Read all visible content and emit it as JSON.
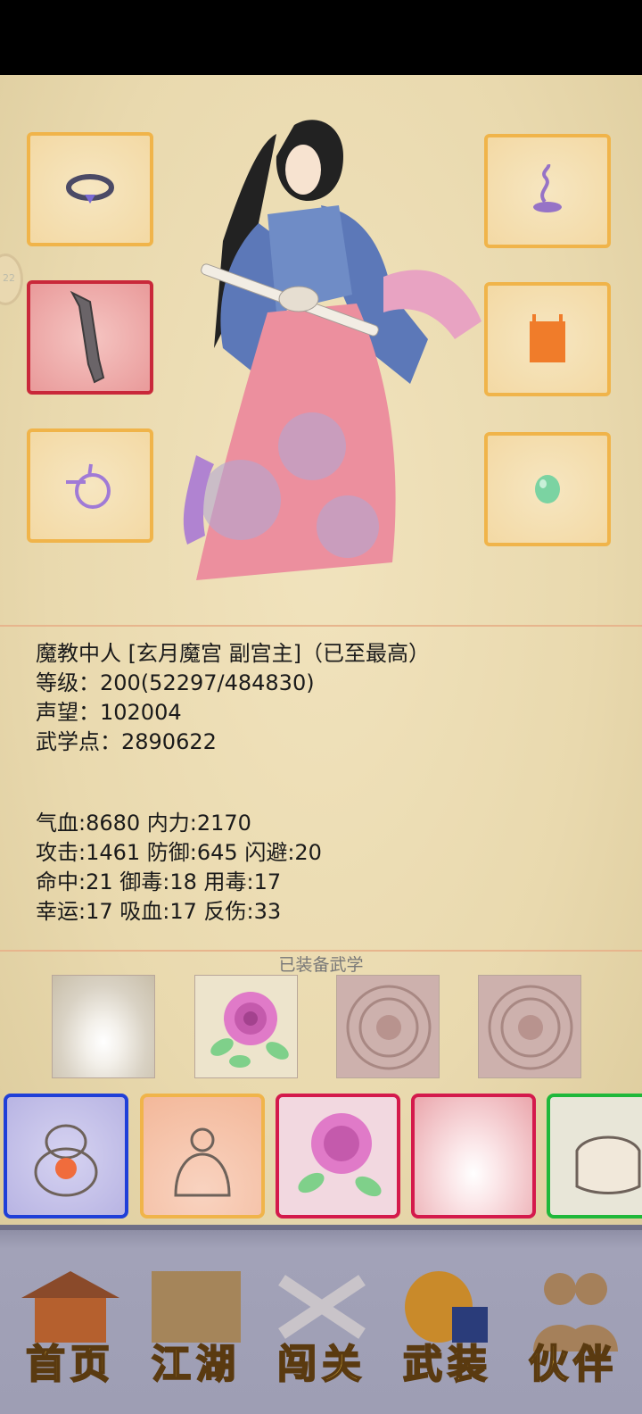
{
  "character": {
    "title": "魔教中人 [玄月魔宫 副宫主]（已至最高）",
    "level": "等级：200(52297/484830)",
    "reputation": "声望：102004",
    "martial_points": "武学点：2890622"
  },
  "stats": {
    "row1": "气血:8680  内力:2170",
    "row2": "攻击:1461  防御:645  闪避:20",
    "row3": "命中:21  御毒:18  用毒:17",
    "row4": "幸运:17  吸血:17  反伤:33"
  },
  "side_handle": "22",
  "equipped_title": "已装备武学",
  "nav": {
    "home": "首页",
    "jianghu": "江湖",
    "chuangguan": "闯关",
    "wuzhuang": "武装",
    "huoban": "伙伴"
  },
  "colors": {
    "slot_border": "#f0b44a",
    "slot_selected": "#c9283a",
    "skill_blue": "#1f3fd8",
    "skill_orange": "#f0b44a",
    "skill_red": "#d41a4c",
    "skill_green": "#1fb83a"
  }
}
